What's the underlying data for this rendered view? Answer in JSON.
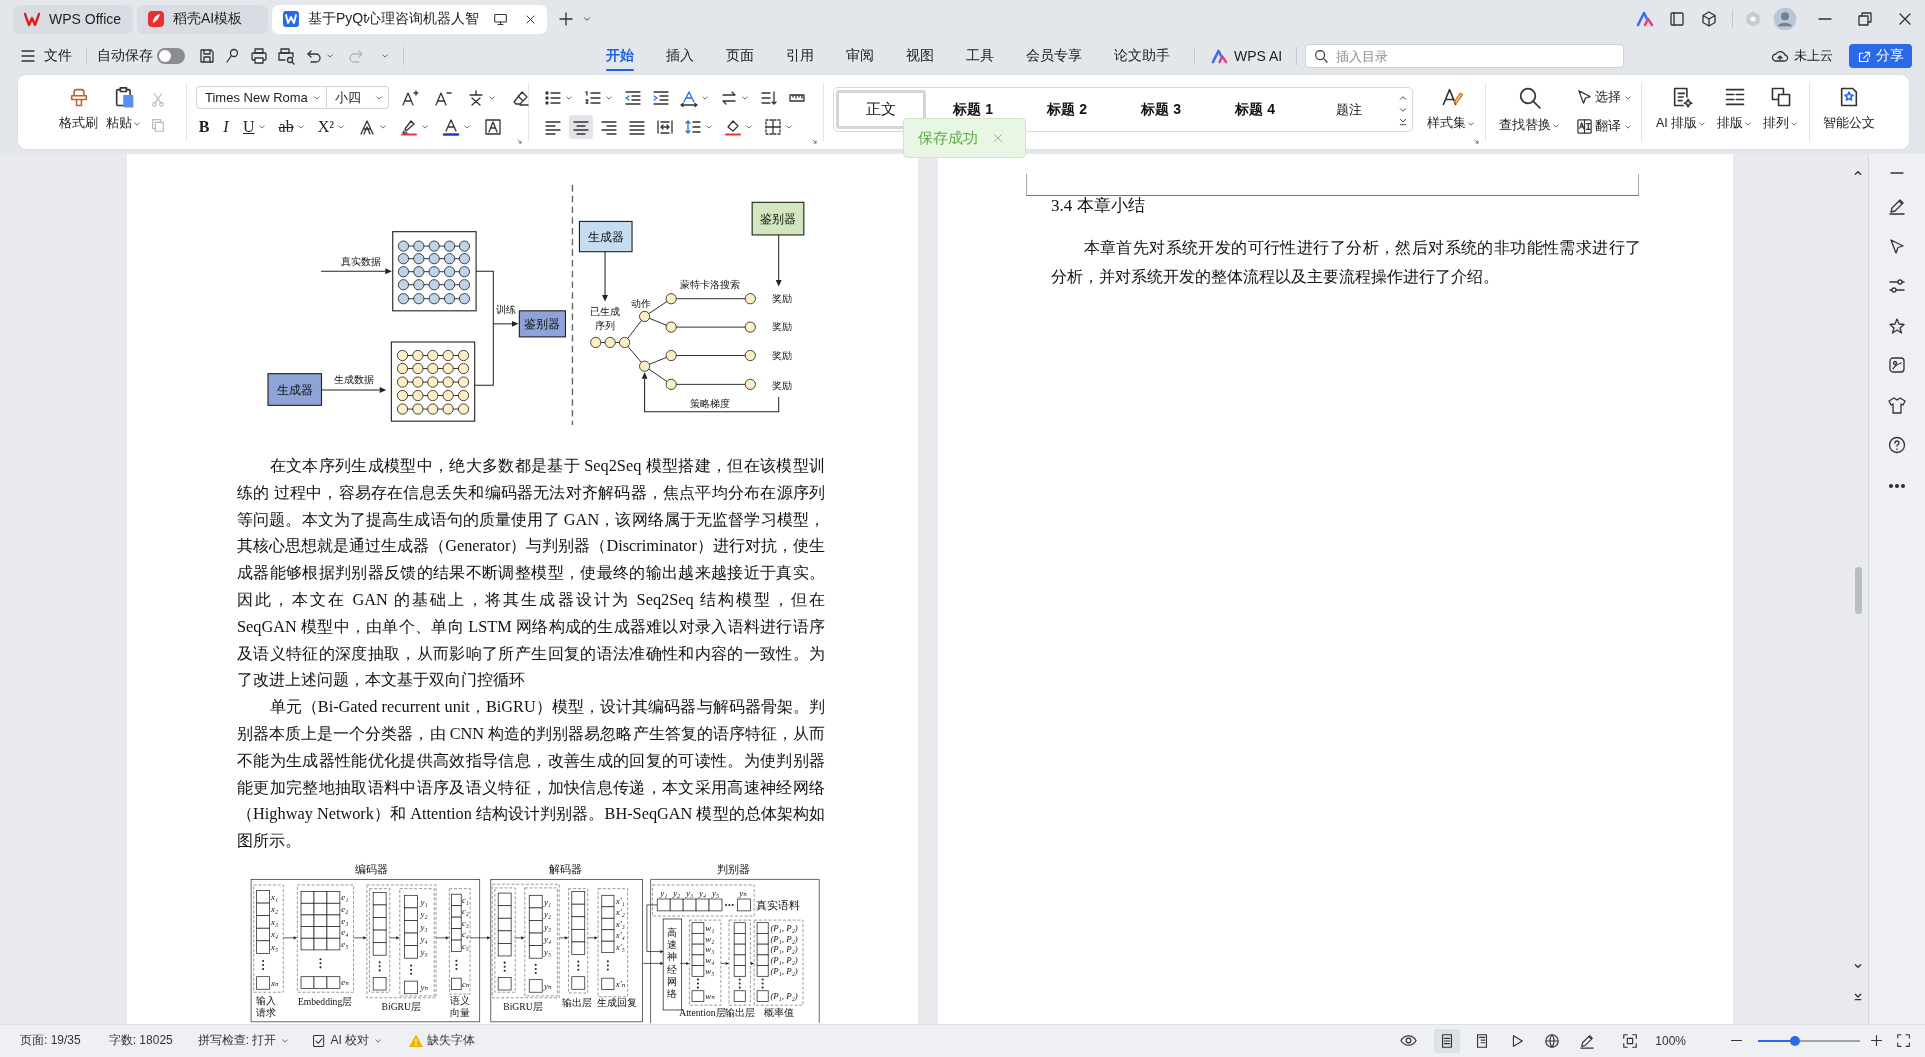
{
  "window_tabs": [
    {
      "label": "WPS Office",
      "kind": "wps",
      "selected": false
    },
    {
      "label": "稻壳AI模板",
      "kind": "docer",
      "selected": false
    },
    {
      "label": "基于PyQt心理咨询机器人智",
      "kind": "writer",
      "selected": true
    }
  ],
  "quick_bar": {
    "file_menu": "文件",
    "autosave_label": "自动保存",
    "autosave_on": false
  },
  "menu_tabs": [
    {
      "label": "开始",
      "selected": true
    },
    {
      "label": "插入",
      "selected": false
    },
    {
      "label": "页面",
      "selected": false
    },
    {
      "label": "引用",
      "selected": false
    },
    {
      "label": "审阅",
      "selected": false
    },
    {
      "label": "视图",
      "selected": false
    },
    {
      "label": "工具",
      "selected": false
    },
    {
      "label": "会员专享",
      "selected": false
    },
    {
      "label": "论文助手",
      "selected": false
    }
  ],
  "ai_button": "WPS AI",
  "search": {
    "placeholder": "插入目录"
  },
  "cloud_status": "未上云",
  "share_button": "分享",
  "ribbon": {
    "format_painter": "格式刷",
    "paste": "粘贴",
    "font_name": "Times New Roma",
    "font_size": "小四",
    "format_buttons": [
      {
        "label": "B",
        "kind": "bold"
      },
      {
        "label": "I",
        "kind": "italic"
      },
      {
        "label": "U",
        "kind": "underline"
      },
      {
        "label": "ab",
        "kind": "strike"
      },
      {
        "label": "X²",
        "kind": "superscript"
      }
    ],
    "alignment": [
      {
        "kind": "left",
        "selected": false
      },
      {
        "kind": "center",
        "selected": true
      },
      {
        "kind": "right",
        "selected": false
      },
      {
        "kind": "justify",
        "selected": false
      },
      {
        "kind": "distributed",
        "selected": false
      }
    ],
    "styles": [
      {
        "label": "正文",
        "kind": "body",
        "selected": true
      },
      {
        "label": "标题 1",
        "kind": "heading",
        "selected": false
      },
      {
        "label": "标题 2",
        "kind": "heading",
        "selected": false
      },
      {
        "label": "标题 3",
        "kind": "heading",
        "selected": false
      },
      {
        "label": "标题 4",
        "kind": "heading",
        "selected": false
      },
      {
        "label": "题注",
        "kind": "caption",
        "selected": false
      }
    ],
    "style_set": "样式集",
    "find_replace": "查找替换",
    "select": "选择",
    "translate": "翻译",
    "ai_layout": "AI 排版",
    "layout": "排版",
    "arrange": "排列",
    "smart_document": "智能公文"
  },
  "toast": {
    "text": "保存成功"
  },
  "left_page": {
    "gan_figure": {
      "real_data": "真实数据",
      "generator": "生成器",
      "generated_data": "生成数据",
      "train": "训练",
      "discriminator": "鉴别器",
      "rollout_generator": "生成器",
      "rollout_discriminator": "鉴别器",
      "sequence": [
        "已生成",
        "序列"
      ],
      "action": "动作",
      "search": "蒙特卡洛搜索",
      "rewards": [
        "奖励",
        "奖励",
        "奖励",
        "奖励"
      ],
      "policy_gradient": "策略梯度"
    },
    "paragraphs": [
      "在文本序列生成模型中，绝大多数都是基于 Seq2Seq 模型搭建，但在该模型训练的 过程中，容易存在信息丢失和编码器无法对齐解码器，焦点平均分布在源序列等问题。本文为了提高生成语句的质量使用了 GAN，该网络属于无监督学习模型，其核心思想就是通过生成器（Generator）与判别器（Discriminator）进行对抗，使生成器能够根据判别器反馈的结果不断调整模型，使最终的输出越来越接近于真实。因此，本文在 GAN 的基础上，将其生成器设计为 Seq2Seq 结构模型，但在 SeqGAN 模型中，由单个、单向 LSTM 网络构成的生成器难以对录入语料进行语序及语义特征的深度抽取，从而影响了所产生回复的语法准确性和内容的一致性。为了改进上述问题，本文基于双向门控循环",
      "单元（Bi-Gated recurrent unit，BiGRU）模型，设计其编码器与解码器骨架。判别器本质上是一个分类器，由 CNN 构造的判别器易忽略产生答复的语序特征，从而不能为生成器性能优化提供高效指导信息，改善生成的回复的可读性。为使判别器能更加完整地抽取语料中语序及语义特征，加快信息传递，本文采用高速神经网络（Highway Network）和 Attention 结构设计判别器。BH-SeqGAN 模型的总体架构如图所示。"
    ],
    "model_figure": {
      "encoder": {
        "title": "编码器",
        "input_labels": [
          "x₁",
          "x₂",
          "x₃",
          "x₄",
          "x₅",
          "xₙ"
        ],
        "input_caption": [
          "输入",
          "请求"
        ],
        "embedding_labels": [
          "e₁",
          "e₂",
          "e₃",
          "e₄",
          "e₅",
          "eₙ"
        ],
        "embedding_caption": "Embedding层",
        "bigru_labels": [
          "y₁",
          "y₂",
          "y₃",
          "y₄",
          "y₅",
          "yₙ"
        ],
        "bigru_caption": "BiGRU层",
        "vector_labels": [
          "c₁",
          "c₂",
          "c₃",
          "c₄",
          "c₅",
          "cₙ"
        ],
        "vector_caption": [
          "语义",
          "向量"
        ]
      },
      "decoder": {
        "title": "解码器",
        "bigru_labels": [
          "y₁",
          "y₂",
          "y₃",
          "y₄",
          "y₅",
          "yₙ"
        ],
        "bigru_caption": "BiGRU层",
        "output_caption": "输出层",
        "reply_labels": [
          "x'₁",
          "x'₂",
          "x'₃",
          "x'₄",
          "x'₅",
          "x'ₙ"
        ],
        "reply_caption": "生成回复"
      },
      "discriminator": {
        "title": "判别器",
        "corpus_labels": [
          "y₁",
          "y₂",
          "y₃",
          "y₄",
          "y₅",
          "yₙ"
        ],
        "corpus_caption": "真实语料",
        "highway": "高速神经网络",
        "attention_labels": [
          "w₁",
          "w₂",
          "w₃",
          "w₄",
          "w₅",
          "wₙ"
        ],
        "attention_caption": "Attention层",
        "output_caption": "输出层",
        "prob_labels": [
          "(P₁, P₂)",
          "(P₁, P₂)",
          "(P₁, P₂)",
          "(P₁, P₂)",
          "(P₁, P₂)",
          "(P₁, P₂)"
        ],
        "prob_caption": "概率值"
      }
    }
  },
  "right_page": {
    "heading": "3.4 本章小结",
    "paragraphs": [
      "本章首先对系统开发的可行性进行了分析，然后对系统的非功能性需求进行了分析，并对系统开发的整体流程以及主要流程操作进行了介绍。"
    ]
  },
  "status_bar": {
    "page": "页面: 19/35",
    "words": "字数: 18025",
    "spell_check": "拼写检查: 打开",
    "ai_proofread": "AI 校对",
    "missing_fonts": "缺失字体",
    "view_modes": [
      {
        "kind": "page",
        "selected": true
      },
      {
        "kind": "outline",
        "selected": false
      },
      {
        "kind": "play",
        "selected": false
      },
      {
        "kind": "web",
        "selected": false
      },
      {
        "kind": "write",
        "selected": false
      }
    ],
    "zoom": "100%",
    "zoom_slider": {
      "level": 0.36
    }
  }
}
